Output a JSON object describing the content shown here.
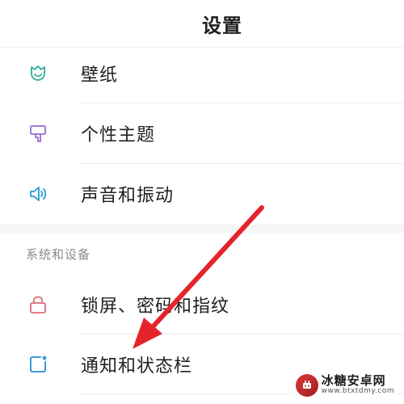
{
  "header": {
    "title": "设置"
  },
  "groups": [
    {
      "items": [
        {
          "label": "壁纸",
          "icon": "wallpaper-icon",
          "color": "#3fb4a3"
        },
        {
          "label": "个性主题",
          "icon": "theme-brush-icon",
          "color": "#a07ad8"
        },
        {
          "label": "声音和振动",
          "icon": "speaker-icon",
          "color": "#3aa5d8"
        }
      ]
    },
    {
      "section_title": "系统和设备",
      "items": [
        {
          "label": "锁屏、密码和指纹",
          "icon": "lock-icon",
          "color": "#e27a87"
        },
        {
          "label": "通知和状态栏",
          "icon": "notification-icon",
          "color": "#3a9ad8"
        }
      ]
    }
  ],
  "annotation": {
    "arrow_color": "#e5232b"
  },
  "watermark": {
    "name": "冰糖安卓网",
    "url": "www.btxtdmy.com"
  }
}
